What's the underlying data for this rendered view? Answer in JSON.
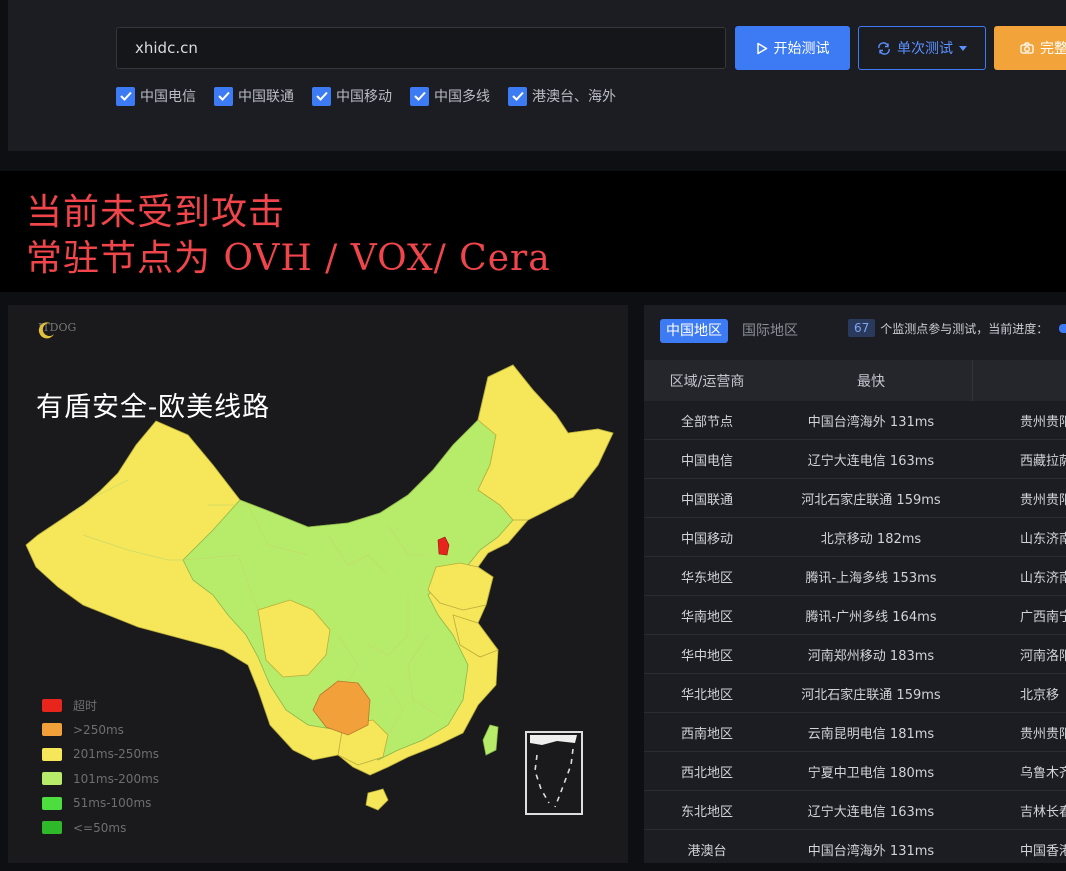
{
  "search": {
    "value": "xhidc.cn"
  },
  "buttons": {
    "start": "开始测试",
    "single": "单次测试",
    "full": "完整"
  },
  "filters": [
    "中国电信",
    "中国联通",
    "中国移动",
    "中国多线",
    "港澳台、海外"
  ],
  "banner": {
    "line1": "当前未受到攻击",
    "line2": "常驻节点为 OVH / VOX/ Cera"
  },
  "map": {
    "logo": "ITDOG",
    "title": "有盾安全-欧美线路",
    "legend": [
      {
        "label": "超时",
        "color": "#e8251c"
      },
      {
        "label": ">250ms",
        "color": "#f2a03a"
      },
      {
        "label": "201ms-250ms",
        "color": "#f5e65a"
      },
      {
        "label": "101ms-200ms",
        "color": "#b7ec6a"
      },
      {
        "label": "51ms-100ms",
        "color": "#4ddd3f"
      },
      {
        "label": "<=50ms",
        "color": "#2fb92a"
      }
    ]
  },
  "results": {
    "tabs": [
      "中国地区",
      "国际地区"
    ],
    "monitor_count": "67",
    "monitor_text": "个监测点参与测试，当前进度：",
    "headers": [
      "区域/运营商",
      "最快",
      ""
    ],
    "rows": [
      {
        "region": "全部节点",
        "fastest": "中国台湾海外 131ms",
        "slowest": "贵州贵阳"
      },
      {
        "region": "中国电信",
        "fastest": "辽宁大连电信 163ms",
        "slowest": "西藏拉萨"
      },
      {
        "region": "中国联通",
        "fastest": "河北石家庄联通 159ms",
        "slowest": "贵州贵阳"
      },
      {
        "region": "中国移动",
        "fastest": "北京移动 182ms",
        "slowest": "山东济南"
      },
      {
        "region": "华东地区",
        "fastest": "腾讯-上海多线 153ms",
        "slowest": "山东济南"
      },
      {
        "region": "华南地区",
        "fastest": "腾讯-广州多线 164ms",
        "slowest": "广西南宁"
      },
      {
        "region": "华中地区",
        "fastest": "河南郑州移动 183ms",
        "slowest": "河南洛阳"
      },
      {
        "region": "华北地区",
        "fastest": "河北石家庄联通 159ms",
        "slowest": "北京移"
      },
      {
        "region": "西南地区",
        "fastest": "云南昆明电信 181ms",
        "slowest": "贵州贵阳"
      },
      {
        "region": "西北地区",
        "fastest": "宁夏中卫电信 180ms",
        "slowest": "乌鲁木齐"
      },
      {
        "region": "东北地区",
        "fastest": "辽宁大连电信 163ms",
        "slowest": "吉林长春"
      },
      {
        "region": "港澳台",
        "fastest": "中国台湾海外 131ms",
        "slowest": "中国香港"
      }
    ]
  }
}
